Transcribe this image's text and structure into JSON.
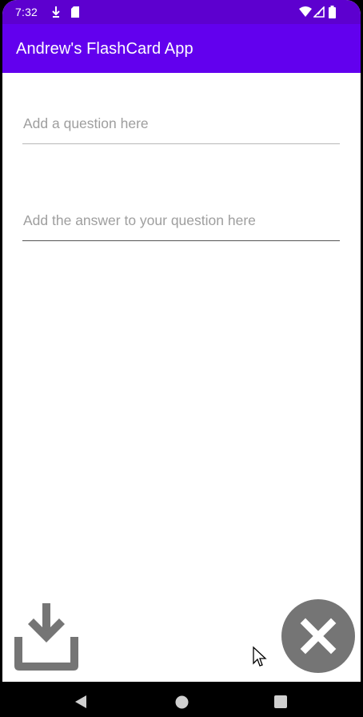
{
  "status_bar": {
    "time": "7:32",
    "icons": [
      "download-arrow-icon",
      "sd-card-icon",
      "wifi-icon",
      "signal-icon",
      "battery-icon"
    ]
  },
  "app_bar": {
    "title": "Andrew's FlashCard App",
    "color": "#6200ee",
    "status_color": "#5d00cf"
  },
  "form": {
    "question": {
      "value": "",
      "placeholder": "Add a question here"
    },
    "answer": {
      "value": "",
      "placeholder": "Add the answer to your question here"
    }
  },
  "actions": {
    "save_icon": "save-download-icon",
    "cancel_icon": "close-icon",
    "icon_color": "#757575"
  },
  "nav_bar": {
    "buttons": [
      "back-icon",
      "home-icon",
      "recents-icon"
    ]
  }
}
